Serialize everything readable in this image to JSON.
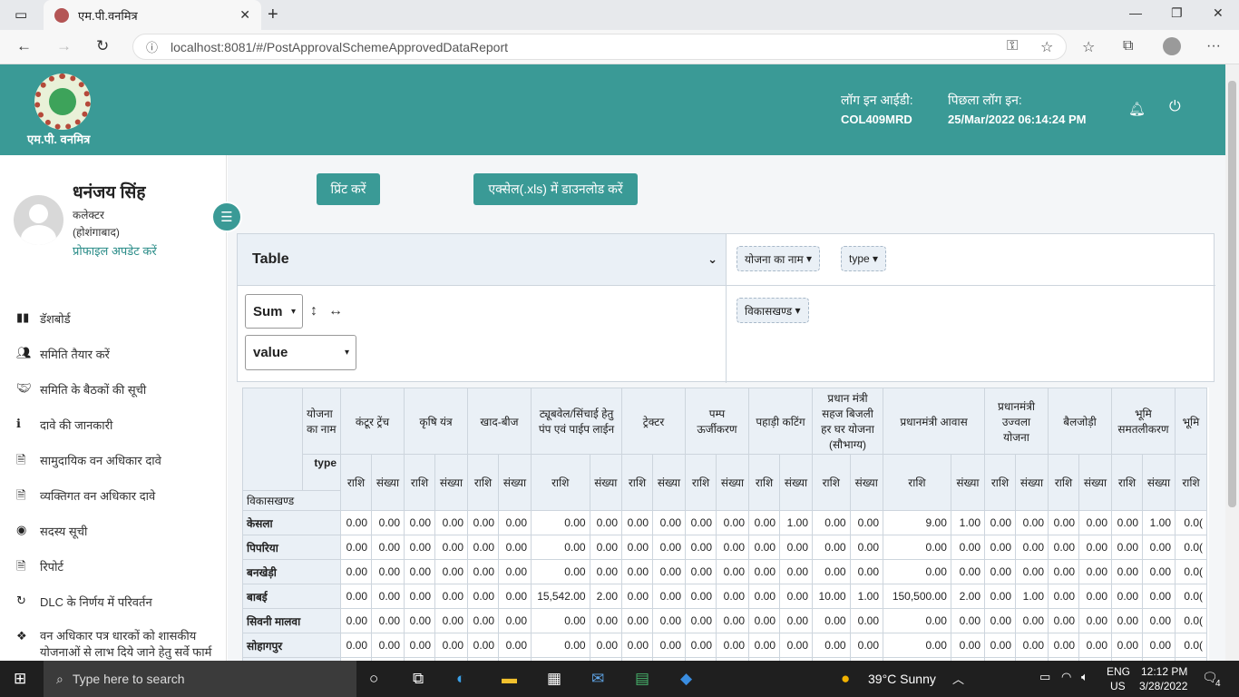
{
  "browser": {
    "tab_title": "एम.पी.वनमित्र",
    "url": "localhost:8081/#/PostApprovalSchemeApprovedDataReport"
  },
  "header": {
    "logo_text": "एम.पी. वनमित्र",
    "login_id_label": "लॉग इन आईडी:",
    "login_id": "COL409MRD",
    "last_login_label": "पिछला लॉग इन:",
    "last_login": "25/Mar/2022 06:14:24 PM"
  },
  "user": {
    "name": "धनंजय सिंह",
    "role": "कलेक्टर",
    "district": "(होशंगाबाद)",
    "profile_link": "प्रोफाइल अपडेट करें"
  },
  "menu": [
    {
      "icon": "chart-icon",
      "label": "डॅशबोर्ड"
    },
    {
      "icon": "users-icon",
      "label": "समिति तैयार करें"
    },
    {
      "icon": "handshake-icon",
      "label": "समिति के बैठकों की सूची"
    },
    {
      "icon": "info-icon",
      "label": "दावे की जानकारी"
    },
    {
      "icon": "document-icon",
      "label": "सामुदायिक वन अधिकार दावे"
    },
    {
      "icon": "document-icon",
      "label": "व्यक्तिगत वन अधिकार दावे"
    },
    {
      "icon": "user-circle-icon",
      "label": "सदस्य सूची"
    },
    {
      "icon": "file-excel-icon",
      "label": "रिपोर्ट"
    },
    {
      "icon": "refresh-icon",
      "label": "DLC के निर्णय में परिवर्तन"
    },
    {
      "icon": "dropbox-icon",
      "label": "वन अधिकार पत्र धारकों को शासकीय योजनाओं से लाभ दिये जाने हेतु सर्वे फार्म"
    }
  ],
  "actions": {
    "print": "प्रिंट करें",
    "excel": "एक्सेल(.xls) में डाउनलोड करें"
  },
  "pivot": {
    "renderer": "Table",
    "aggregator": "Sum",
    "value_field": "value",
    "col_chips": [
      "योजना का नाम",
      "type"
    ],
    "row_chips": [
      "विकासखण्ड"
    ]
  },
  "table": {
    "corner_top": "योजना का नाम",
    "corner_mid": "type",
    "row_attr": "विकासखण्ड",
    "schemes": [
      "कंटूर ट्रेंच",
      "कृषि यंत्र",
      "खाद-बीज",
      "ट्यूबवेल/सिंचाई हेतु पंप एवं पाईप लाईन",
      "ट्रेक्टर",
      "पम्प ऊर्जीकरण",
      "पहाड़ी कटिंग",
      "प्रधान मंत्री सहज बिजली हर घर योजना (सौभाग्य)",
      "प्रधानमंत्री आवास",
      "प्रधानमंत्री उज्वला योजना",
      "बैलजोड़ी",
      "भूमि समतलीकरण",
      "भूमि"
    ],
    "sub_types": [
      "राशि",
      "संख्या"
    ],
    "rows": [
      {
        "name": "केसला",
        "values": [
          "0.00",
          "0.00",
          "0.00",
          "0.00",
          "0.00",
          "0.00",
          "0.00",
          "0.00",
          "0.00",
          "0.00",
          "0.00",
          "0.00",
          "0.00",
          "1.00",
          "0.00",
          "0.00",
          "9.00",
          "1.00",
          "0.00",
          "0.00",
          "0.00",
          "0.00",
          "0.00",
          "1.00",
          "0.0("
        ]
      },
      {
        "name": "पिपरिया",
        "values": [
          "0.00",
          "0.00",
          "0.00",
          "0.00",
          "0.00",
          "0.00",
          "0.00",
          "0.00",
          "0.00",
          "0.00",
          "0.00",
          "0.00",
          "0.00",
          "0.00",
          "0.00",
          "0.00",
          "0.00",
          "0.00",
          "0.00",
          "0.00",
          "0.00",
          "0.00",
          "0.00",
          "0.00",
          "0.0("
        ]
      },
      {
        "name": "बनखेड़ी",
        "values": [
          "0.00",
          "0.00",
          "0.00",
          "0.00",
          "0.00",
          "0.00",
          "0.00",
          "0.00",
          "0.00",
          "0.00",
          "0.00",
          "0.00",
          "0.00",
          "0.00",
          "0.00",
          "0.00",
          "0.00",
          "0.00",
          "0.00",
          "0.00",
          "0.00",
          "0.00",
          "0.00",
          "0.00",
          "0.0("
        ]
      },
      {
        "name": "बाबई",
        "values": [
          "0.00",
          "0.00",
          "0.00",
          "0.00",
          "0.00",
          "0.00",
          "15,542.00",
          "2.00",
          "0.00",
          "0.00",
          "0.00",
          "0.00",
          "0.00",
          "0.00",
          "10.00",
          "1.00",
          "150,500.00",
          "2.00",
          "0.00",
          "1.00",
          "0.00",
          "0.00",
          "0.00",
          "0.00",
          "0.0("
        ]
      },
      {
        "name": "सिवनी मालवा",
        "values": [
          "0.00",
          "0.00",
          "0.00",
          "0.00",
          "0.00",
          "0.00",
          "0.00",
          "0.00",
          "0.00",
          "0.00",
          "0.00",
          "0.00",
          "0.00",
          "0.00",
          "0.00",
          "0.00",
          "0.00",
          "0.00",
          "0.00",
          "0.00",
          "0.00",
          "0.00",
          "0.00",
          "0.00",
          "0.0("
        ]
      },
      {
        "name": "सोहागपुर",
        "values": [
          "0.00",
          "0.00",
          "0.00",
          "0.00",
          "0.00",
          "0.00",
          "0.00",
          "0.00",
          "0.00",
          "0.00",
          "0.00",
          "0.00",
          "0.00",
          "0.00",
          "0.00",
          "0.00",
          "0.00",
          "0.00",
          "0.00",
          "0.00",
          "0.00",
          "0.00",
          "0.00",
          "0.00",
          "0.0("
        ]
      }
    ]
  },
  "taskbar": {
    "search_placeholder": "Type here to search",
    "weather": "39°C  Sunny",
    "lang": "ENG",
    "region": "US",
    "time": "12:12 PM",
    "date": "3/28/2022",
    "notif_count": "4"
  }
}
